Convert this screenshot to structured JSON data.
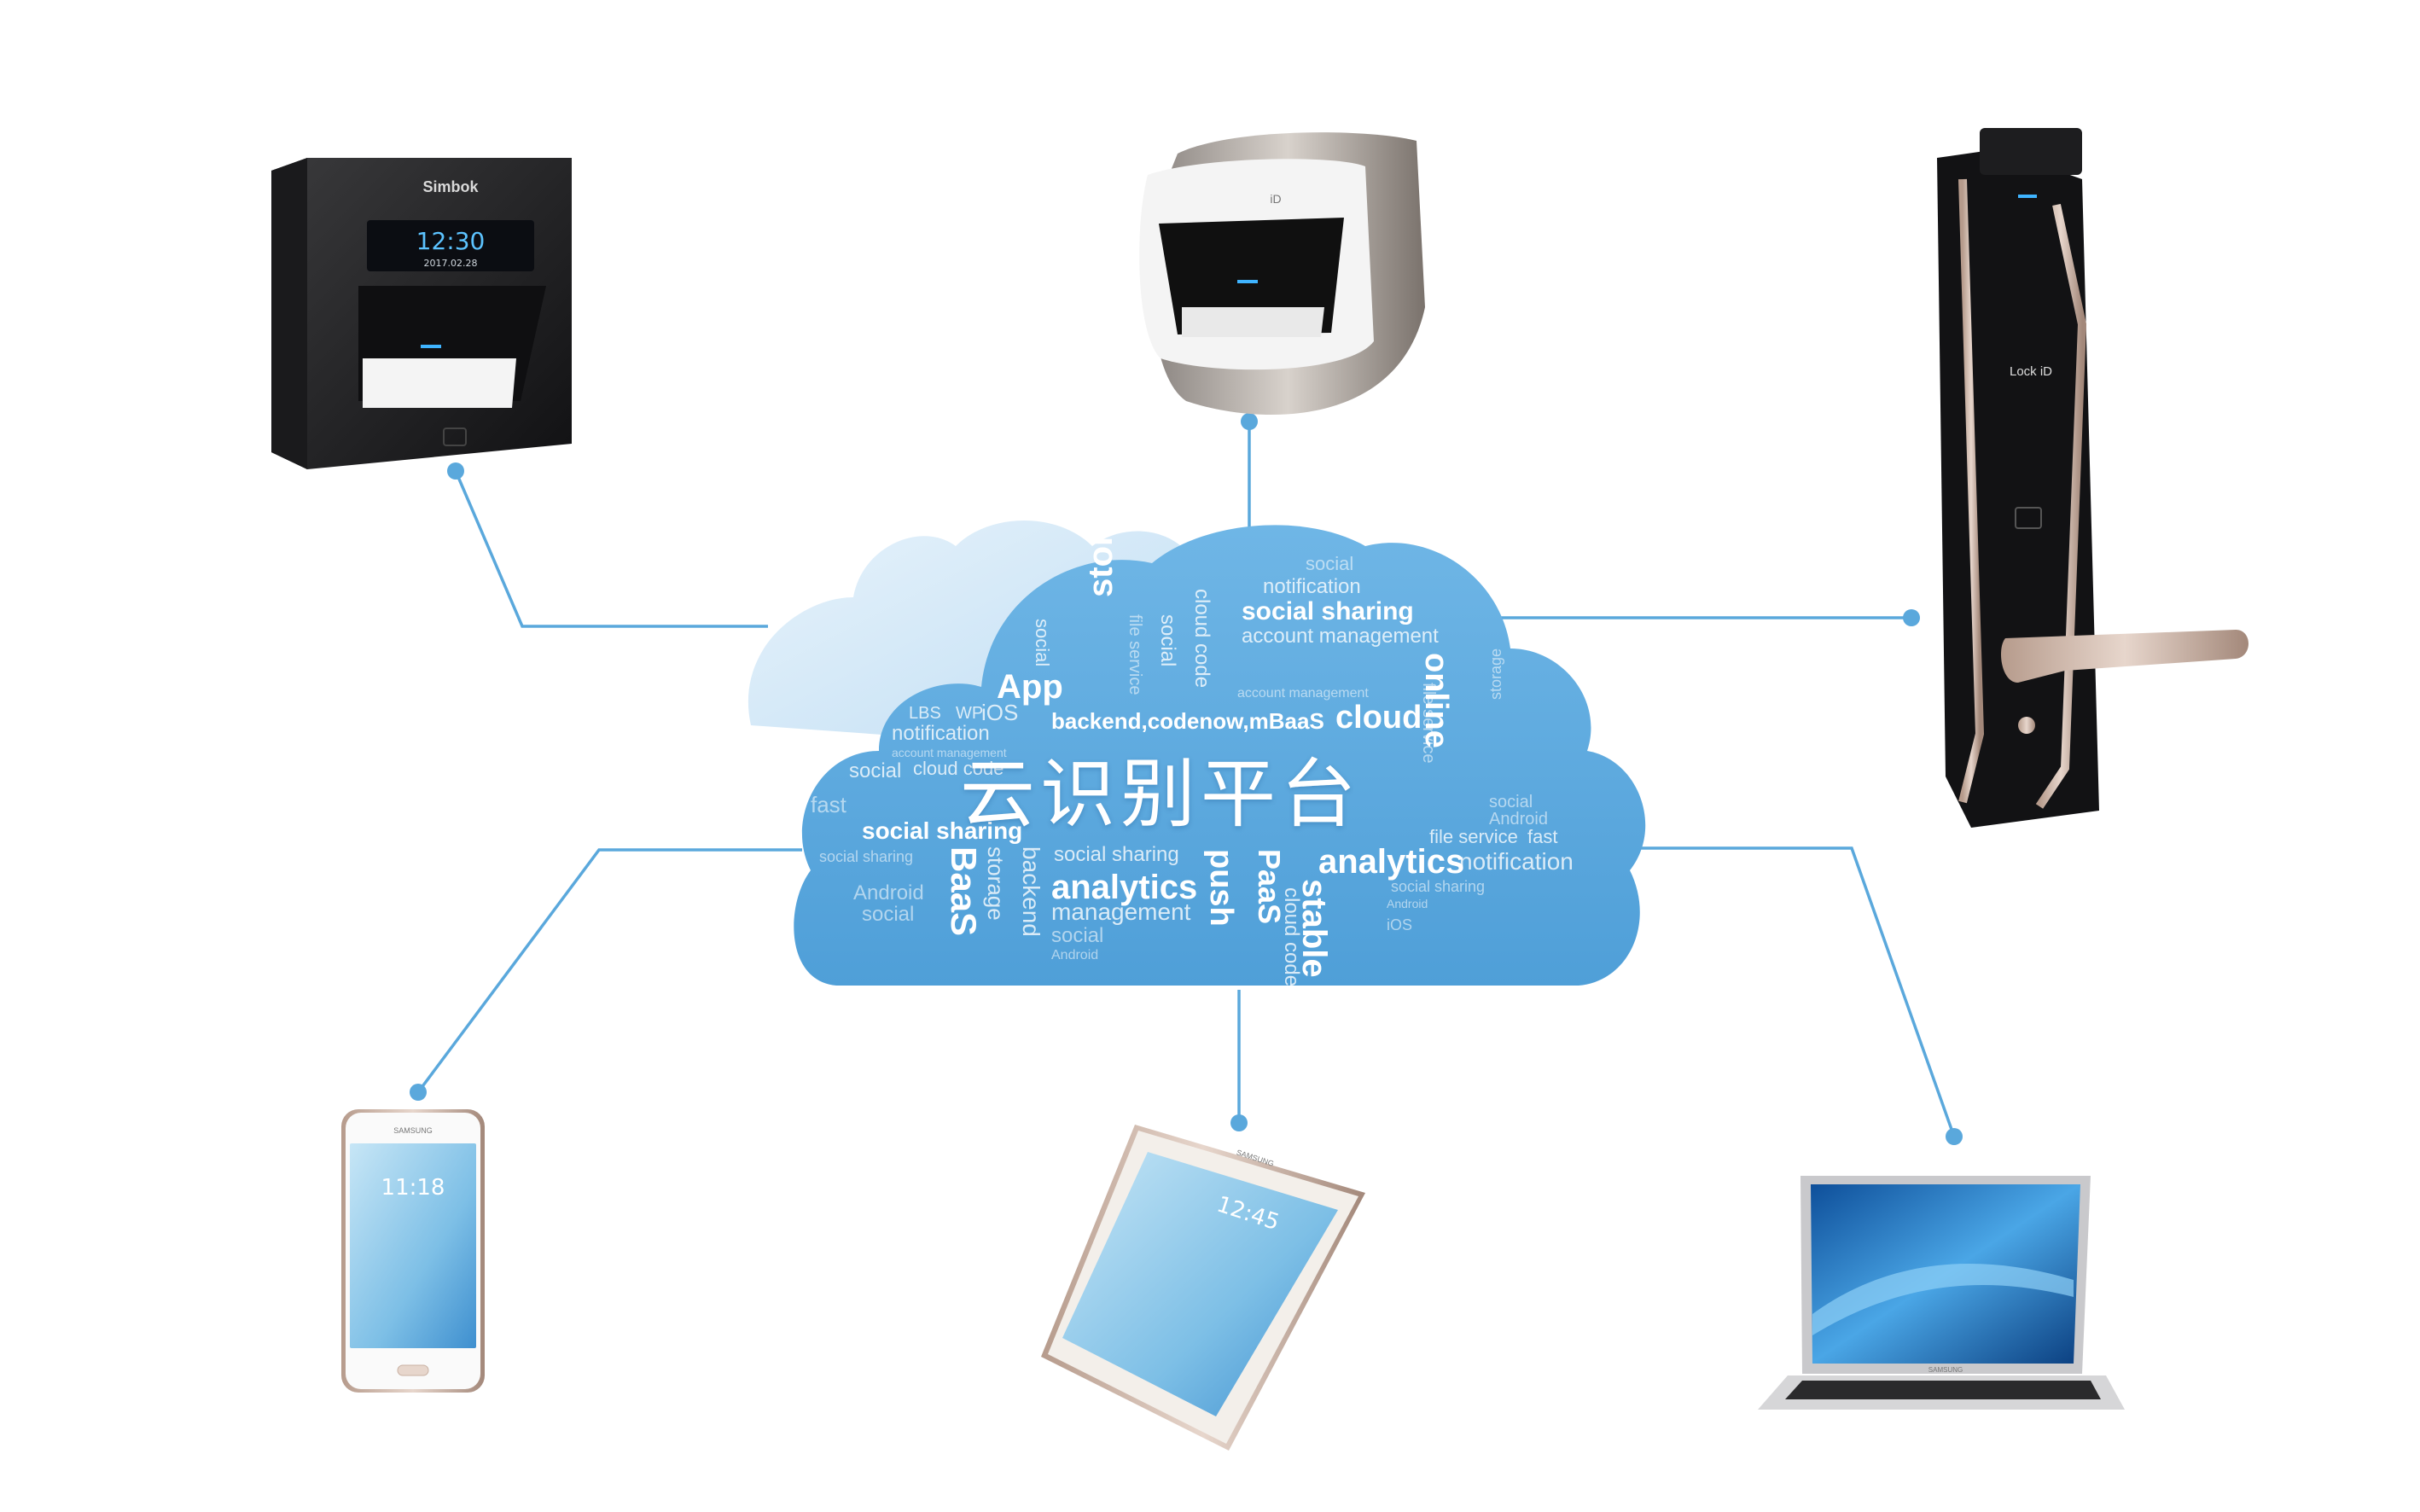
{
  "diagram": {
    "center_label": "云识别平台",
    "word_cloud": [
      "social",
      "notification",
      "social sharing",
      "account management",
      "storage",
      "cloud code",
      "file service",
      "social",
      "App",
      "LBS",
      "WP",
      "iOS",
      "backend,codenow,mBaaS",
      "cloud",
      "online",
      "file service",
      "storage",
      "social",
      "notification",
      "account management",
      "social",
      "cloud code",
      "fast",
      "social sharing",
      "BaaS",
      "storage",
      "backend",
      "social sharing",
      "analytics",
      "push",
      "PaaS",
      "stable",
      "cloud code",
      "analytics",
      "notification",
      "file service",
      "fast",
      "social",
      "Android",
      "social sharing",
      "management",
      "social",
      "Android",
      "iOS",
      "social",
      "Android",
      "social sharing",
      "account management",
      "Android"
    ],
    "nodes": [
      {
        "id": "terminal",
        "name": "fingerprint-terminal",
        "screen_time": "12:30",
        "screen_date": "2017.02.28",
        "brand": "Simbok"
      },
      {
        "id": "reader",
        "name": "desktop-fingerprint-reader",
        "brand": "iD"
      },
      {
        "id": "lock",
        "name": "smart-door-lock",
        "brand": "Lock iD"
      },
      {
        "id": "phone",
        "name": "smartphone",
        "brand": "SAMSUNG",
        "screen_time": "11:18"
      },
      {
        "id": "tablet",
        "name": "tablet",
        "brand": "SAMSUNG",
        "screen_time": "12:45"
      },
      {
        "id": "laptop",
        "name": "laptop",
        "brand": "SAMSUNG"
      }
    ]
  },
  "colors": {
    "connector": "#5aa8dc",
    "cloud_main": "#5aa9de",
    "cloud_light": "#cfe6f6",
    "dot": "#5aa8dc"
  }
}
